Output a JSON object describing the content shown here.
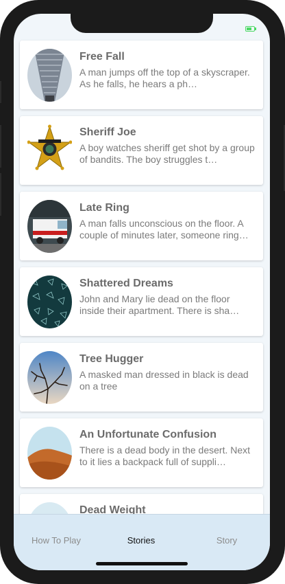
{
  "status": {
    "battery_color": "#4cd964"
  },
  "stories": [
    {
      "title": "Free Fall",
      "description": "A man jumps off the top of a skyscraper. As he falls, he hears a ph…",
      "thumbnail": "skyscraper-image"
    },
    {
      "title": "Sheriff Joe",
      "description": "A boy watches sheriff get shot by a group of bandits. The boy struggles t…",
      "thumbnail": "sheriff-badge-image"
    },
    {
      "title": "Late Ring",
      "description": "A man falls unconscious on the floor. A couple of minutes later, someone ring…",
      "thumbnail": "ambulance-image"
    },
    {
      "title": "Shattered Dreams",
      "description": "John and Mary lie dead on the floor inside their apartment. There is sha…",
      "thumbnail": "broken-glass-image"
    },
    {
      "title": "Tree Hugger",
      "description": "A masked man dressed in black is dead on a tree",
      "thumbnail": "bare-tree-image"
    },
    {
      "title": "An Unfortunate Confusion",
      "description": "There is a dead body in the desert. Next to it lies a backpack full of suppli…",
      "thumbnail": "desert-dune-image"
    },
    {
      "title": "Dead Weight",
      "description": "",
      "thumbnail": "partial-image"
    }
  ],
  "tabs": [
    {
      "label": "How To Play",
      "active": false
    },
    {
      "label": "Stories",
      "active": true
    },
    {
      "label": "Story",
      "active": false
    }
  ],
  "colors": {
    "tab_bar": "#d9e9f5",
    "title_text": "#6b6b6b",
    "description_text": "#7a7a7a"
  }
}
